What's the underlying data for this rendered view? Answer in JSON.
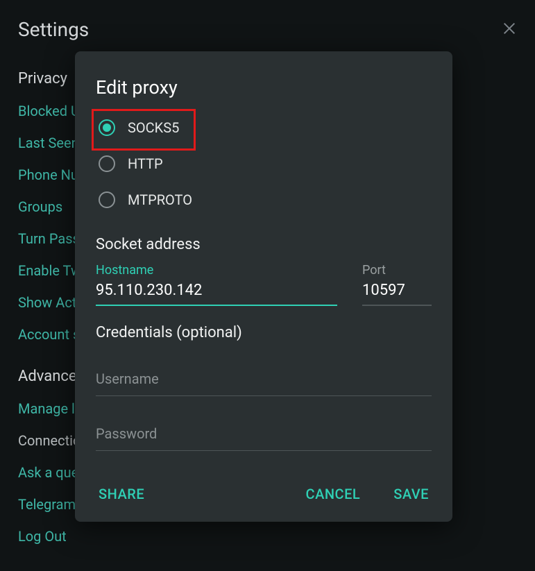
{
  "settings_title": "Settings",
  "sections": {
    "privacy": {
      "head": "Privacy",
      "items": [
        "Blocked Users",
        "Last Seen",
        "Phone Number",
        "Groups",
        "Turn Passcode On",
        "Enable Two-Step Verification",
        "Show Active Sessions",
        "Account self-destructs"
      ]
    },
    "advanced": {
      "head": "Advanced",
      "items": [
        {
          "label": "Manage local storage",
          "class": "link-item"
        },
        {
          "label": "Connection type",
          "class": "link-item muted"
        },
        {
          "label": "Ask a question",
          "class": "link-item"
        },
        {
          "label": "Telegram FAQ",
          "class": "link-item"
        },
        {
          "label": "Log Out",
          "class": "link-item"
        }
      ]
    }
  },
  "close_icon": "close-icon",
  "modal": {
    "title": "Edit proxy",
    "radios": [
      {
        "value": "SOCKS5",
        "checked": true,
        "highlight": true
      },
      {
        "value": "HTTP",
        "checked": false,
        "highlight": false
      },
      {
        "value": "MTPROTO",
        "checked": false,
        "highlight": false
      }
    ],
    "socket_head": "Socket address",
    "hostname_label": "Hostname",
    "hostname_value": "95.110.230.142",
    "port_label": "Port",
    "port_value": "10597",
    "credentials_head": "Credentials (optional)",
    "username_placeholder": "Username",
    "username_value": "",
    "password_placeholder": "Password",
    "password_value": "",
    "share": "SHARE",
    "cancel": "CANCEL",
    "save": "SAVE"
  }
}
